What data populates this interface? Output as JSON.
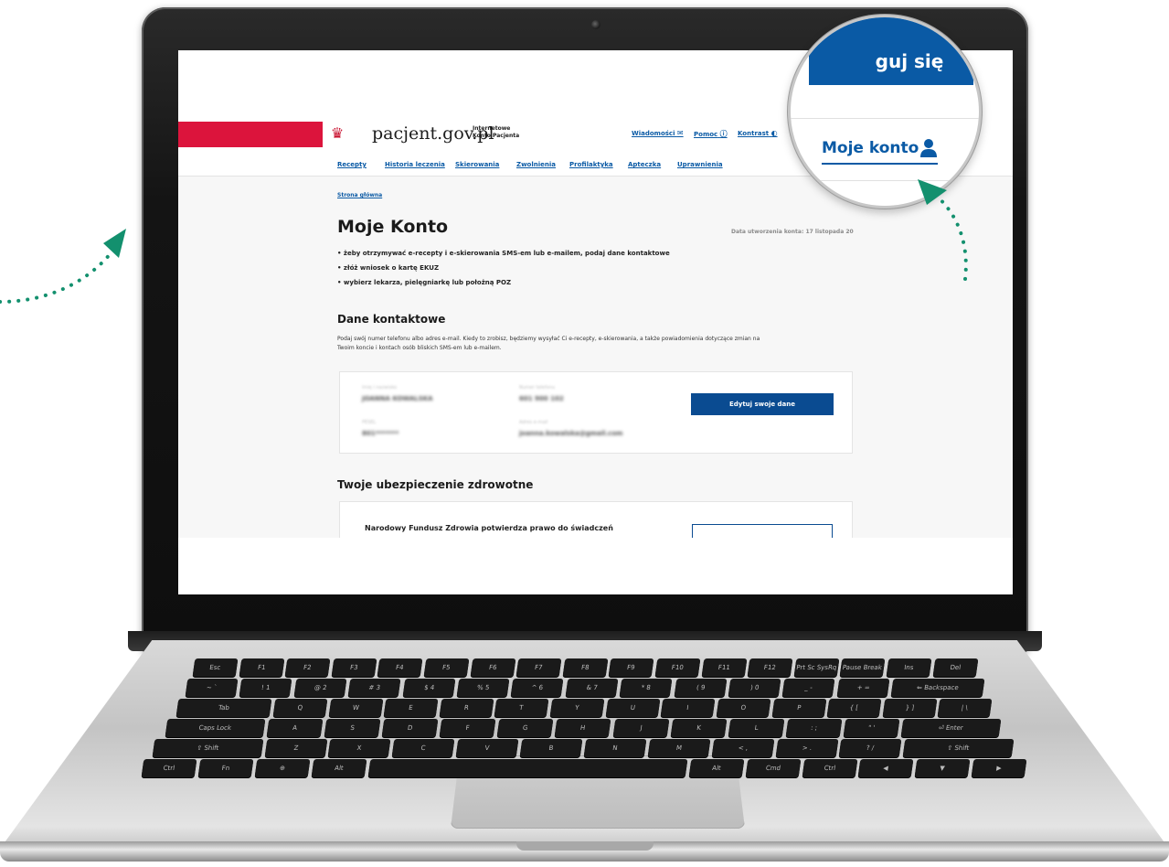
{
  "site": {
    "brand": "pacjent.gov.pl",
    "brand_sub": "Internetowe Konto Pacjenta"
  },
  "header": {
    "messages": "Wiadomości",
    "help": "Pomoc",
    "contrast": "Kontrast"
  },
  "nav": {
    "items": [
      {
        "label": "Recepty"
      },
      {
        "label": "Historia leczenia"
      },
      {
        "label": "Skierowania"
      },
      {
        "label": "Zwolnienia"
      },
      {
        "label": "Profilaktyka"
      },
      {
        "label": "Apteczka"
      },
      {
        "label": "Uprawnienia"
      }
    ]
  },
  "breadcrumb": "Strona główna",
  "page": {
    "title": "Moje Konto",
    "created": "Data utworzenia konta: 17 listopada 20",
    "bullets": [
      "• żeby otrzymywać e-recepty i e-skierowania SMS-em lub e-mailem, podaj dane kontaktowe",
      "• złóż wniosek o kartę EKUZ",
      "• wybierz lekarza, pielęgniarkę lub położną POZ"
    ]
  },
  "contact": {
    "title": "Dane kontaktowe",
    "description": "Podaj swój numer telefonu albo adres e-mail. Kiedy to zrobisz, będziemy wysyłać Ci e-recepty, e-skierowania, a także powiadomienia dotyczące zmian na Twoim koncie i kontach osób bliskich SMS-em lub e-mailem.",
    "fields": [
      {
        "label": "Imię i nazwisko",
        "value": "JOANNA KOWALSKA"
      },
      {
        "label": "Numer telefonu",
        "value": "601 900 102"
      },
      {
        "label": "PESEL",
        "value": "801*******"
      },
      {
        "label": "Adres e-mail",
        "value": "joanna.kowalska@gmail.com"
      }
    ],
    "edit_button": "Edytuj swoje dane"
  },
  "insurance": {
    "title": "Twoje ubezpieczenie zdrowotne",
    "text": "Narodowy Fundusz Zdrowia potwierdza prawo do świadczeń"
  },
  "magnifier": {
    "login_text": "guj się",
    "account_text": "Moje konto"
  },
  "colors": {
    "brand_blue": "#0a5aa5",
    "button_blue": "#0a4b91",
    "flag_red": "#dc143c",
    "arrow_green": "#13906e"
  },
  "keyboard": {
    "rows": [
      [
        "Esc",
        "F1",
        "F2",
        "F3",
        "F4",
        "F5",
        "F6",
        "F7",
        "F8",
        "F9",
        "F10",
        "F11",
        "F12",
        "Prt Sc SysRq",
        "Pause Break",
        "Ins",
        "Del"
      ],
      [
        "~ `",
        "! 1",
        "@ 2",
        "# 3",
        "$ 4",
        "% 5",
        "^ 6",
        "& 7",
        "* 8",
        "( 9",
        ") 0",
        "_ -",
        "+ =",
        "⇐ Backspace"
      ],
      [
        "Tab",
        "Q",
        "W",
        "E",
        "R",
        "T",
        "Y",
        "U",
        "I",
        "O",
        "P",
        "{ [",
        "} ]",
        "| \\"
      ],
      [
        "Caps Lock",
        "A",
        "S",
        "D",
        "F",
        "G",
        "H",
        "J",
        "K",
        "L",
        ": ;",
        "\" '",
        "⏎ Enter"
      ],
      [
        "⇧ Shift",
        "Z",
        "X",
        "C",
        "V",
        "B",
        "N",
        "M",
        "< ,",
        "> .",
        "? /",
        "⇧ Shift"
      ],
      [
        "Ctrl",
        "Fn",
        "⊕",
        "Alt",
        "",
        "Alt",
        "Cmd",
        "Ctrl",
        "◀",
        "▼",
        "▶"
      ]
    ]
  }
}
